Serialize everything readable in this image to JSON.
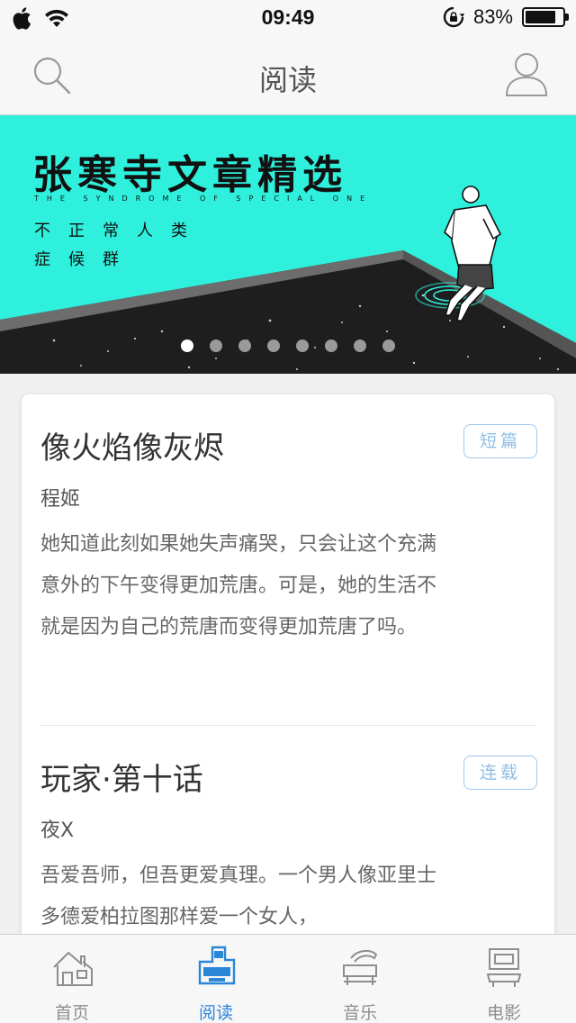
{
  "status_bar": {
    "time": "09:49",
    "battery_percent": "83%",
    "battery_level": 0.83,
    "icons": [
      "apple-icon",
      "wifi-icon",
      "rotation-lock-icon",
      "battery-icon"
    ]
  },
  "nav": {
    "title": "阅读",
    "left_icon": "search-icon",
    "right_icon": "user-icon"
  },
  "banner": {
    "title": "张寒寺文章精选",
    "subtitle_en": "THE SYNDROME OF SPECIAL ONE",
    "subtitle_line1": "不正常人类",
    "subtitle_line2": "症候群",
    "page_count": 8,
    "active_page": 1,
    "colors": {
      "background": "#2ff0dc",
      "platform": "#1e1e1e"
    }
  },
  "articles": [
    {
      "title": "像火焰像灰烬",
      "tag": "短篇",
      "author": "程姬",
      "excerpt": "她知道此刻如果她失声痛哭，只会让这个充满意外的下午变得更加荒唐。可是，她的生活不就是因为自己的荒唐而变得更加荒唐了吗。"
    },
    {
      "title": "玩家·第十话",
      "tag": "连载",
      "author": "夜X",
      "excerpt": "吾爱吾师，但吾更爱真理。一个男人像亚里士多德爱柏拉图那样爱一个女人，"
    }
  ],
  "tabs": [
    {
      "label": "首页",
      "icon": "home-icon",
      "active": false
    },
    {
      "label": "阅读",
      "icon": "reading-icon",
      "active": true
    },
    {
      "label": "音乐",
      "icon": "music-icon",
      "active": false
    },
    {
      "label": "电影",
      "icon": "movie-icon",
      "active": false
    }
  ],
  "colors": {
    "accent": "#2b86d8",
    "tag_border": "#9ec8ee"
  }
}
